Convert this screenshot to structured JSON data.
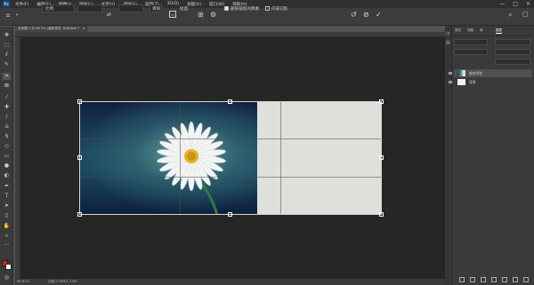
{
  "app": {
    "logo": "Ps"
  },
  "menu": [
    "文件(F)",
    "编辑(E)",
    "图像(I)",
    "图层(L)",
    "文字(Y)",
    "选择(S)",
    "滤镜(T)",
    "3D(D)",
    "视图(V)",
    "窗口(W)",
    "帮助(H)"
  ],
  "window_controls": [
    "—",
    "□",
    "×"
  ],
  "options": {
    "ratio_label": "比例",
    "clear_label": "清除",
    "straighten_label": "拉直",
    "delete_cropped_label": "删除裁剪的像素",
    "content_aware_label": "内容识别",
    "delete_cropped_checked": true,
    "content_aware_checked": false
  },
  "document": {
    "tab_title": "未标题-1 @ 66.7% (裁剪预览, RGB/8#) *",
    "close": "×"
  },
  "status": {
    "zoom": "66.67%",
    "doc_info": "文档:2.93M/1.71M"
  },
  "panels": {
    "tabs": [
      "属性",
      "调整",
      "库",
      "图层"
    ],
    "active_tab": "图层",
    "layers": [
      {
        "name": "裁剪预览",
        "active": true
      },
      {
        "name": "背景",
        "active": false
      }
    ]
  },
  "colors": {
    "foreground": "#d81e1e",
    "background": "#ffffff",
    "accent": "#1b4f8e"
  }
}
